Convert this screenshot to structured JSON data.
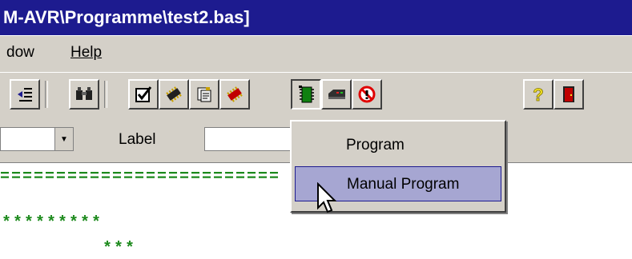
{
  "window": {
    "title": "M-AVR\\Programme\\test2.bas]"
  },
  "menubar": {
    "items": [
      {
        "label": "dow"
      },
      {
        "label": "Help"
      }
    ]
  },
  "toolbar": {
    "buttons": [
      {
        "icon": "outdent-icon"
      },
      {
        "icon": "binoculars-find-icon"
      },
      {
        "icon": "checkbox-check-icon"
      },
      {
        "icon": "chip-compile-icon"
      },
      {
        "icon": "clipboard-report-icon"
      },
      {
        "icon": "chip-red-icon"
      },
      {
        "icon": "program-chip-icon"
      },
      {
        "icon": "terminal-emulator-icon"
      },
      {
        "icon": "no-entry-icon"
      },
      {
        "icon": "help-icon"
      },
      {
        "icon": "exit-door-icon"
      }
    ]
  },
  "labelbar": {
    "label": "Label"
  },
  "dropdown": {
    "items": [
      {
        "label": "Program",
        "selected": false
      },
      {
        "label": "Manual Program",
        "selected": true
      }
    ]
  },
  "editor": {
    "lines": [
      "=========================",
      "*********",
      "***"
    ]
  },
  "colors": {
    "title_bg": "#1d1b8f",
    "menu_bg": "#d4d0c8",
    "highlight": "#a6a6d2",
    "code": "#1c8a1c"
  }
}
